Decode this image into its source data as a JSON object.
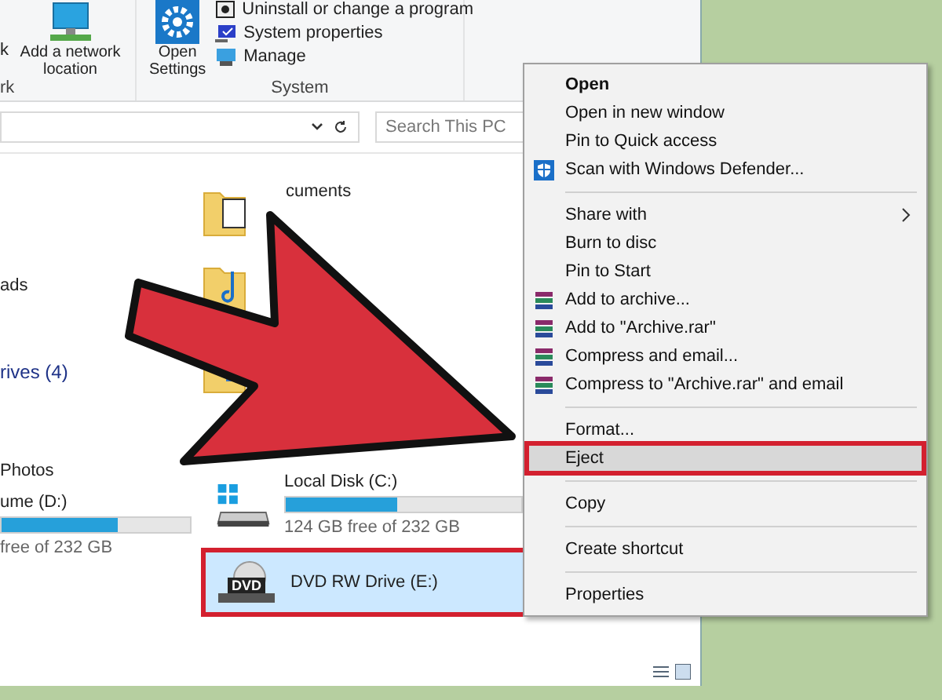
{
  "ribbon": {
    "groups": [
      {
        "cut_text": "k",
        "buttons": [
          {
            "label": "Add a network location",
            "kind": "network"
          }
        ],
        "label": "rk"
      },
      {
        "buttons": [
          {
            "label": "Open Settings",
            "kind": "gear"
          }
        ],
        "small_items": [
          {
            "label": "Uninstall or change a program",
            "kind": "box"
          },
          {
            "label": "System properties",
            "kind": "monitor"
          },
          {
            "label": "Manage",
            "kind": "computer"
          }
        ],
        "label": "System"
      }
    ]
  },
  "search": {
    "placeholder": "Search This PC"
  },
  "folders": [
    {
      "label": "cuments",
      "kind": "document"
    },
    {
      "kind": "music"
    },
    {
      "kind": "picture"
    }
  ],
  "nav": {
    "partial_item": "ads",
    "section": "rives (4)"
  },
  "left_drives": [
    {
      "label": "Photos"
    },
    {
      "label": "ume (D:)",
      "level": 0.62,
      "reading": "free of 232 GB"
    }
  ],
  "drives": [
    {
      "kind": "disk",
      "label": "Local Disk (C:)",
      "level": 0.47,
      "reading": "124 GB free of 232 GB",
      "selected": false
    },
    {
      "kind": "dvd",
      "label": "DVD RW Drive (E:)",
      "badge": "DVD",
      "selected": true
    }
  ],
  "context_menu": [
    {
      "kind": "item",
      "label": "Open",
      "default": true,
      "selected": false
    },
    {
      "kind": "item",
      "label": "Open in new window",
      "default": false,
      "selected": false
    },
    {
      "kind": "item",
      "label": "Pin to Quick access",
      "default": false,
      "selected": false
    },
    {
      "kind": "shield",
      "label": "Scan with Windows Defender...",
      "default": false,
      "selected": false
    },
    {
      "kind": "separator"
    },
    {
      "kind": "item",
      "label": "Share with",
      "submenu": true,
      "default": false,
      "selected": false
    },
    {
      "kind": "item",
      "label": "Burn to disc",
      "default": false,
      "selected": false
    },
    {
      "kind": "item",
      "label": "Pin to Start",
      "default": false,
      "selected": false
    },
    {
      "kind": "archive",
      "label": "Add to archive...",
      "default": false,
      "selected": false
    },
    {
      "kind": "archive",
      "label": "Add to \"Archive.rar\"",
      "default": false,
      "selected": false
    },
    {
      "kind": "archive",
      "label": "Compress and email...",
      "default": false,
      "selected": false
    },
    {
      "kind": "archive",
      "label": "Compress to \"Archive.rar\" and email",
      "default": false,
      "selected": false
    },
    {
      "kind": "separator"
    },
    {
      "kind": "item",
      "label": "Format...",
      "default": false,
      "selected": false
    },
    {
      "kind": "item",
      "label": "Eject",
      "default": false,
      "selected": true
    },
    {
      "kind": "separator"
    },
    {
      "kind": "item",
      "label": "Copy",
      "default": false,
      "selected": false
    },
    {
      "kind": "separator"
    },
    {
      "kind": "item",
      "label": "Create shortcut",
      "default": false,
      "selected": false
    },
    {
      "kind": "separator"
    },
    {
      "kind": "item",
      "label": "Properties",
      "default": false,
      "selected": false
    }
  ]
}
